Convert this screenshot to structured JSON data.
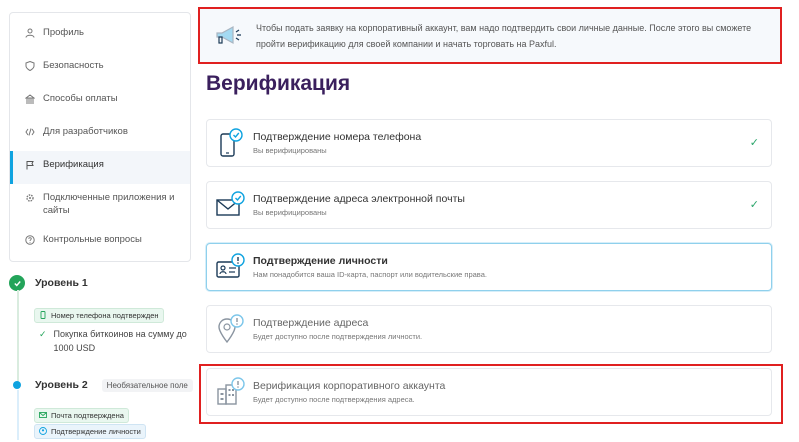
{
  "sidebar": {
    "items": [
      {
        "label": "Профиль",
        "icon": "user-icon"
      },
      {
        "label": "Безопасность",
        "icon": "shield-icon"
      },
      {
        "label": "Способы оплаты",
        "icon": "bank-icon"
      },
      {
        "label": "Для разработчиков",
        "icon": "code-icon"
      },
      {
        "label": "Верификация",
        "icon": "flag-icon",
        "active": true
      },
      {
        "label": "Подключенные приложения и сайты",
        "icon": "gear-icon"
      },
      {
        "label": "Контрольные вопросы",
        "icon": "question-icon"
      }
    ]
  },
  "levels": {
    "level1": {
      "title": "Уровень 1",
      "badge": "Номер телефона подтвержден",
      "item": "Покупка биткоинов на сумму до 1000 USD"
    },
    "level2": {
      "title": "Уровень 2",
      "optional": "Необязательное поле",
      "badge_email": "Почта подтверждена",
      "badge_identity": "Подтверждение личности"
    }
  },
  "banner": {
    "text": "Чтобы подать заявку на корпоративный аккаунт, вам надо подтвердить свои личные данные. После этого вы сможете пройти верификацию для своей компании и начать торговать на Paxful."
  },
  "page_title": "Верификация",
  "cards": [
    {
      "title": "Подтверждение номера телефона",
      "subtitle": "Вы верифицированы",
      "status": "verified"
    },
    {
      "title": "Подтверждение адреса электронной почты",
      "subtitle": "Вы верифицированы",
      "status": "verified"
    },
    {
      "title": "Подтверждение личности",
      "subtitle": "Нам понадобится ваша ID-карта, паспорт или водительские права.",
      "status": "active"
    },
    {
      "title": "Подтверждение адреса",
      "subtitle": "Будет доступно после подтверждения личности.",
      "status": "locked"
    },
    {
      "title": "Верификация корпоративного аккаунта",
      "subtitle": "Будет доступно после подтверждения адреса.",
      "status": "locked"
    }
  ],
  "colors": {
    "accent": "#0fa3e0",
    "success": "#23a45a",
    "title": "#3a1f5d",
    "highlight": "#e02020"
  }
}
